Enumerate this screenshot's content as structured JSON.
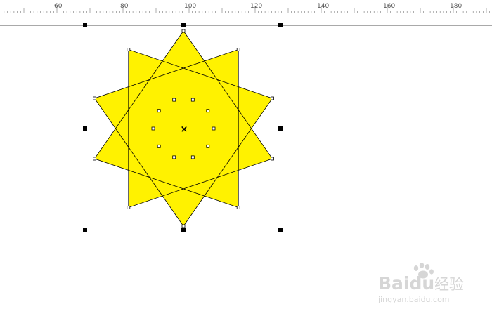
{
  "ruler": {
    "labels": [
      "60",
      "80",
      "100",
      "120",
      "140",
      "160",
      "180"
    ]
  },
  "canvas": {
    "star": {
      "points": 10,
      "fill": "#FFF200",
      "stroke": "#000000"
    },
    "selection": {
      "handle_color": "#000000",
      "center_mark": "×"
    }
  },
  "watermark": {
    "brand": "Bai",
    "brand_tail": "du",
    "product": "经验",
    "url": "jingyan.baidu.com"
  }
}
